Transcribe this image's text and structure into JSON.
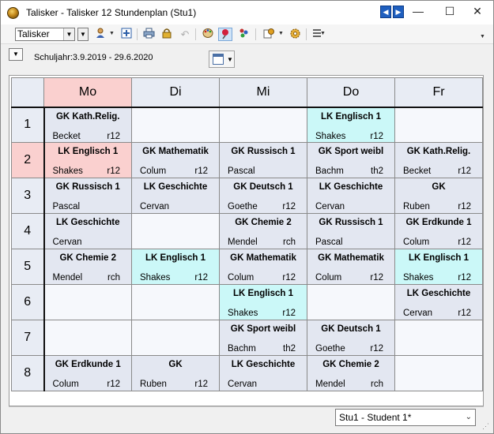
{
  "window": {
    "title": "Talisker - Talisker 12  Stundenplan  (Stu1)",
    "prev_label": "◀",
    "next_label": "▶",
    "minimize_label": "—",
    "maximize_label": "☐",
    "close_label": "✕"
  },
  "toolbar": {
    "element_combo_value": "Talisker",
    "combo_arrow": "▼",
    "icons": [
      "person-icon",
      "grid-add-icon",
      "print-icon",
      "lock-icon",
      "undo-icon",
      "palette-icon",
      "pin-icon",
      "people-icon",
      "settings-icon",
      "gear-icon",
      "list-icon"
    ]
  },
  "subbar": {
    "school_year": "Schuljahr:3.9.2019 - 29.6.2020",
    "drop_label": "▼",
    "view_caret": "▼"
  },
  "timetable": {
    "days": [
      "Mo",
      "Di",
      "Mi",
      "Do",
      "Fr"
    ],
    "today_index": 0,
    "periods": [
      "1",
      "2",
      "3",
      "4",
      "5",
      "6",
      "7",
      "8"
    ],
    "current_period_index": 1,
    "rows": [
      [
        {
          "subject": "GK Kath.Relig.",
          "teacher": "Becket",
          "room": "r12",
          "hl": false
        },
        null,
        null,
        {
          "subject": "LK Englisch 1",
          "teacher": "Shakes",
          "room": "r12",
          "hl": true
        },
        null
      ],
      [
        {
          "subject": "LK Englisch 1",
          "teacher": "Shakes",
          "room": "r12",
          "hl": false
        },
        {
          "subject": "GK Mathematik",
          "teacher": "Colum",
          "room": "r12",
          "hl": false
        },
        {
          "subject": "GK Russisch 1",
          "teacher": "Pascal",
          "room": "",
          "hl": false
        },
        {
          "subject": "GK Sport weibl",
          "teacher": "Bachm",
          "room": "th2",
          "hl": false
        },
        {
          "subject": "GK Kath.Relig.",
          "teacher": "Becket",
          "room": "r12",
          "hl": false
        }
      ],
      [
        {
          "subject": "GK Russisch 1",
          "teacher": "Pascal",
          "room": "",
          "hl": false
        },
        {
          "subject": "LK Geschichte",
          "teacher": "Cervan",
          "room": "",
          "hl": false
        },
        {
          "subject": "GK Deutsch 1",
          "teacher": "Goethe",
          "room": "r12",
          "hl": false
        },
        {
          "subject": "LK Geschichte",
          "teacher": "Cervan",
          "room": "",
          "hl": false
        },
        {
          "subject": "GK",
          "teacher": "Ruben",
          "room": "r12",
          "hl": false
        }
      ],
      [
        {
          "subject": "LK Geschichte",
          "teacher": "Cervan",
          "room": "",
          "hl": false
        },
        null,
        {
          "subject": "GK Chemie 2",
          "teacher": "Mendel",
          "room": "rch",
          "hl": false
        },
        {
          "subject": "GK Russisch 1",
          "teacher": "Pascal",
          "room": "",
          "hl": false
        },
        {
          "subject": "GK Erdkunde 1",
          "teacher": "Colum",
          "room": "r12",
          "hl": false
        }
      ],
      [
        {
          "subject": "GK Chemie 2",
          "teacher": "Mendel",
          "room": "rch",
          "hl": false
        },
        {
          "subject": "LK Englisch 1",
          "teacher": "Shakes",
          "room": "r12",
          "hl": true
        },
        {
          "subject": "GK Mathematik",
          "teacher": "Colum",
          "room": "r12",
          "hl": false
        },
        {
          "subject": "GK Mathematik",
          "teacher": "Colum",
          "room": "r12",
          "hl": false
        },
        {
          "subject": "LK Englisch 1",
          "teacher": "Shakes",
          "room": "r12",
          "hl": true
        }
      ],
      [
        null,
        null,
        {
          "subject": "LK Englisch 1",
          "teacher": "Shakes",
          "room": "r12",
          "hl": true
        },
        null,
        {
          "subject": "LK Geschichte",
          "teacher": "Cervan",
          "room": "r12",
          "hl": false
        }
      ],
      [
        null,
        null,
        {
          "subject": "GK Sport weibl",
          "teacher": "Bachm",
          "room": "th2",
          "hl": false
        },
        {
          "subject": "GK Deutsch 1",
          "teacher": "Goethe",
          "room": "r12",
          "hl": false
        },
        null
      ],
      [
        {
          "subject": "GK Erdkunde 1",
          "teacher": "Colum",
          "room": "r12",
          "hl": false
        },
        {
          "subject": "GK",
          "teacher": "Ruben",
          "room": "r12",
          "hl": false
        },
        {
          "subject": "LK Geschichte",
          "teacher": "Cervan",
          "room": "",
          "hl": false
        },
        {
          "subject": "GK Chemie 2",
          "teacher": "Mendel",
          "room": "rch",
          "hl": false
        },
        null
      ]
    ]
  },
  "footer": {
    "student_select_value": "Stu1 - Student 1*",
    "select_arrow": "⌄"
  },
  "colors": {
    "today": "#fad0cf",
    "highlight": "#cbf8f8",
    "filled": "#e3e7f1"
  }
}
